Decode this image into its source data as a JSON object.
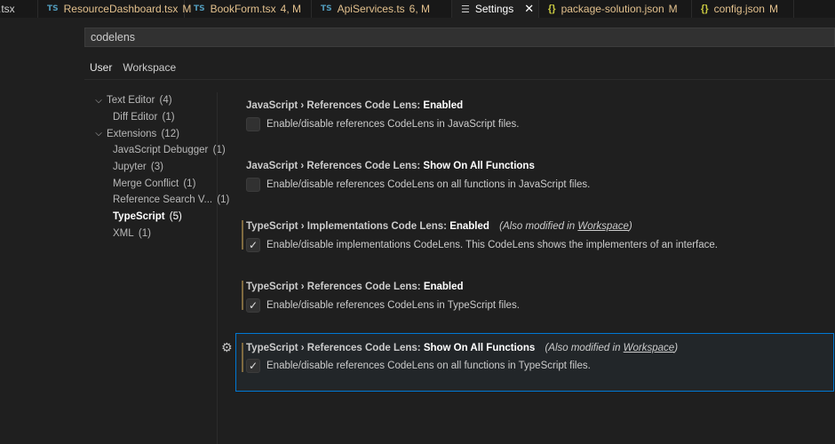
{
  "tabs": [
    {
      "label": ".tsx",
      "icon": "",
      "modified": "",
      "active": false
    },
    {
      "label": "ResourceDashboard.tsx",
      "icon": "TS",
      "modified": "M",
      "active": false
    },
    {
      "label": "BookForm.tsx",
      "icon": "TS",
      "modified": "4, M",
      "active": false
    },
    {
      "label": "ApiServices.ts",
      "icon": "TS",
      "modified": "6, M",
      "active": false
    },
    {
      "label": "Settings",
      "icon": "settings",
      "modified": "",
      "active": true
    },
    {
      "label": "package-solution.json",
      "icon": "{}",
      "modified": "M",
      "active": false
    },
    {
      "label": "config.json",
      "icon": "{}",
      "modified": "M",
      "active": false
    }
  ],
  "search": {
    "value": "codelens"
  },
  "scopes": {
    "user": "User",
    "workspace": "Workspace"
  },
  "toc": [
    {
      "label": "Text Editor",
      "count": "(4)"
    },
    {
      "label": "Diff Editor",
      "count": "(1)"
    },
    {
      "label": "Extensions",
      "count": "(12)"
    },
    {
      "label": "JavaScript Debugger",
      "count": "(1)"
    },
    {
      "label": "Jupyter",
      "count": "(3)"
    },
    {
      "label": "Merge Conflict",
      "count": "(1)"
    },
    {
      "label": "Reference Search V...",
      "count": "(1)"
    },
    {
      "label": "TypeScript",
      "count": "(5)"
    },
    {
      "label": "XML",
      "count": "(1)"
    }
  ],
  "settings": [
    {
      "category": "JavaScript › References Code Lens: ",
      "key": "Enabled",
      "also_prefix": "",
      "also_link": "",
      "also_suffix": "",
      "checked": "",
      "description": "Enable/disable references CodeLens in JavaScript files."
    },
    {
      "category": "JavaScript › References Code Lens: ",
      "key": "Show On All Functions",
      "also_prefix": "",
      "also_link": "",
      "also_suffix": "",
      "checked": "",
      "description": "Enable/disable references CodeLens on all functions in JavaScript files."
    },
    {
      "category": "TypeScript › Implementations Code Lens: ",
      "key": "Enabled",
      "also_prefix": "(Also modified in ",
      "also_link": "Workspace",
      "also_suffix": ")",
      "checked": "✓",
      "description": "Enable/disable implementations CodeLens. This CodeLens shows the implementers of an interface."
    },
    {
      "category": "TypeScript › References Code Lens: ",
      "key": "Enabled",
      "also_prefix": "",
      "also_link": "",
      "also_suffix": "",
      "checked": "✓",
      "description": "Enable/disable references CodeLens in TypeScript files."
    },
    {
      "category": "TypeScript › References Code Lens: ",
      "key": "Show On All Functions",
      "also_prefix": "(Also modified in ",
      "also_link": "Workspace",
      "also_suffix": ")",
      "checked": "✓",
      "description": "Enable/disable references CodeLens on all functions in TypeScript files."
    }
  ],
  "icons": {
    "chevron": "chevron-down-icon",
    "gear": "gear-icon",
    "check": "check-icon",
    "close": "close-icon"
  },
  "colors": {
    "accent": "#0078d4",
    "modified": "#e2c08d",
    "ts_icon": "#519aba",
    "json_icon": "#cbcb41"
  }
}
